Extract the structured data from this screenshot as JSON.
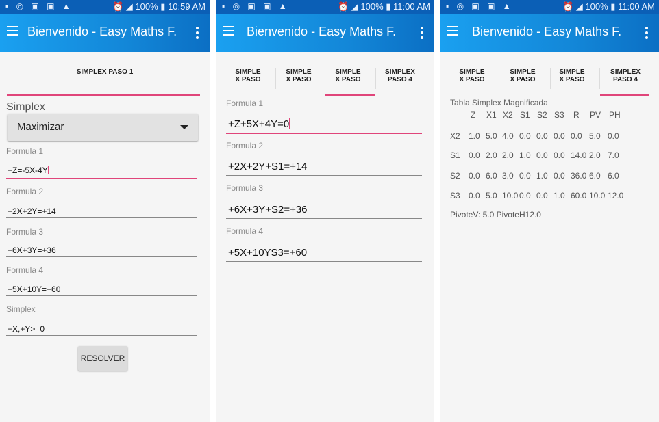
{
  "panel1": {
    "status": {
      "time": "10:59 AM",
      "battery": "100%"
    },
    "toolbar": {
      "title": "Bienvenido - Easy Maths F."
    },
    "tab": "SIMPLEX PASO 1",
    "simplex_label": "Simplex",
    "spinner_value": "Maximizar",
    "fields": [
      {
        "label": "Formula 1",
        "value": "+Z=-5X-4Y"
      },
      {
        "label": "Formula 2",
        "value": "+2X+2Y=+14"
      },
      {
        "label": "Formula 3",
        "value": "+6X+3Y=+36"
      },
      {
        "label": "Formula 4",
        "value": "+5X+10Y=+60"
      },
      {
        "label": "Simplex",
        "value": "+X,+Y>=0"
      }
    ],
    "button": "RESOLVER"
  },
  "panel2": {
    "status": {
      "time": "11:00 AM",
      "battery": "100%"
    },
    "toolbar": {
      "title": "Bienvenido - Easy Maths F."
    },
    "tabs": [
      {
        "line1": "SIMPLE",
        "line2": "X PASO"
      },
      {
        "line1": "SIMPLE",
        "line2": "X PASO"
      },
      {
        "line1": "SIMPLE",
        "line2": "X PASO"
      },
      {
        "line1": "SIMPLEX",
        "line2": "PASO 4"
      }
    ],
    "fields": [
      {
        "label": "Formula 1",
        "value": "+Z+5X+4Y=0"
      },
      {
        "label": "Formula 2",
        "value": "+2X+2Y+S1=+14"
      },
      {
        "label": "Formula 3",
        "value": "+6X+3Y+S2=+36"
      },
      {
        "label": "Formula 4",
        "value": "+5X+10YS3=+60"
      }
    ]
  },
  "panel3": {
    "status": {
      "time": "11:00 AM",
      "battery": "100%"
    },
    "toolbar": {
      "title": "Bienvenido - Easy Maths F."
    },
    "tabs": [
      {
        "line1": "SIMPLE",
        "line2": "X PASO"
      },
      {
        "line1": "SIMPLE",
        "line2": "X PASO"
      },
      {
        "line1": "SIMPLE",
        "line2": "X PASO"
      },
      {
        "line1": "SIMPLEX",
        "line2": "PASO 4"
      }
    ],
    "table_title": "Tabla Simplex Magnificada",
    "headers": [
      "Z",
      "X1",
      "X2",
      "S1",
      "S2",
      "S3",
      "R",
      "PV",
      "PH"
    ],
    "rows": [
      {
        "name": "X2",
        "cells": [
          "1.0",
          "5.0",
          "4.0",
          "0.0",
          "0.0",
          "0.0",
          "0.0",
          "5.0",
          "0.0"
        ]
      },
      {
        "name": "S1",
        "cells": [
          "0.0",
          "2.0",
          "2.0",
          "1.0",
          "0.0",
          "0.0",
          "14.0",
          "2.0",
          "7.0"
        ]
      },
      {
        "name": "S2",
        "cells": [
          "0.0",
          "6.0",
          "3.0",
          "0.0",
          "1.0",
          "0.0",
          "36.0",
          "6.0",
          "6.0"
        ]
      },
      {
        "name": "S3",
        "cells": [
          "0.0",
          "5.0",
          "10.0",
          "0.0",
          "0.0",
          "1.0",
          "60.0",
          "10.0",
          "12.0"
        ]
      }
    ],
    "pivote": "PivoteV: 5.0 PivoteH12.0"
  }
}
